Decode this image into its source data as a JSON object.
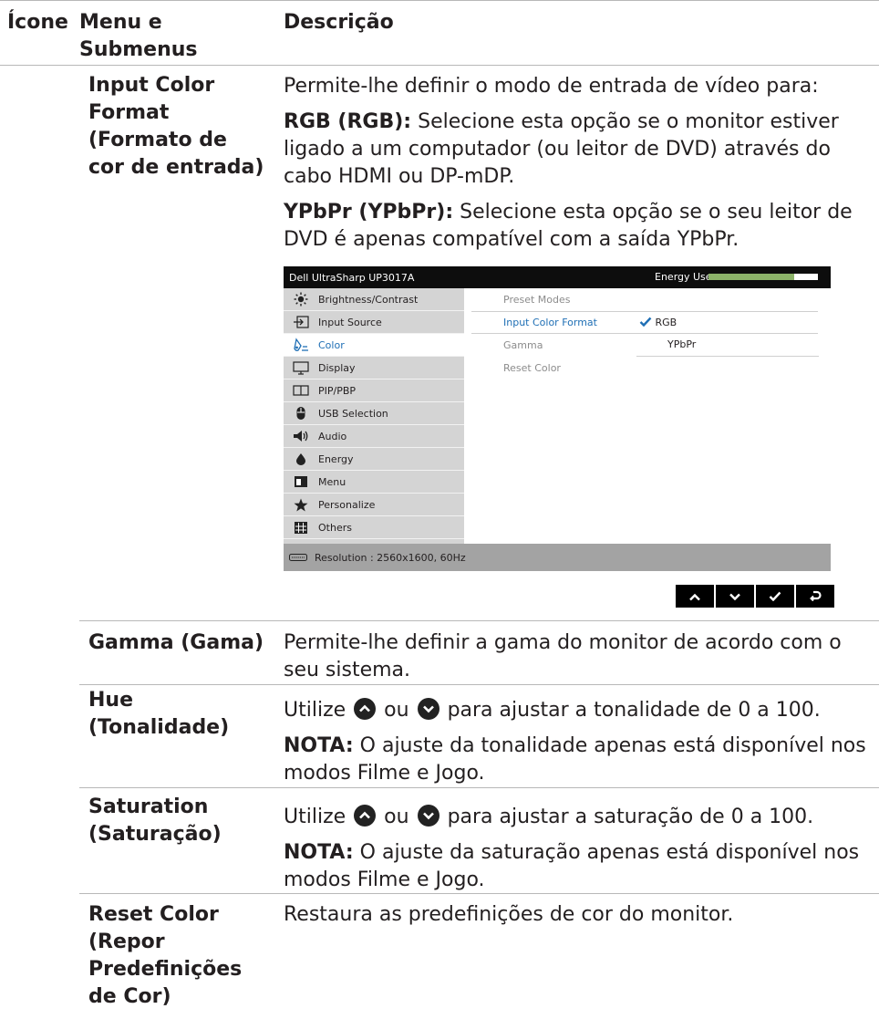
{
  "header": {
    "icon": "Ícone",
    "menu_line1": "Menu e",
    "menu_line2": "Submenus",
    "desc": "Descrição"
  },
  "rows": {
    "input_color": {
      "term": [
        "Input Color",
        "Format",
        "(Formato de",
        "cor de entrada)"
      ],
      "intro": "Permite-lhe definir o modo de entrada de vídeo para:",
      "rgb_bold": "RGB (RGB):",
      "rgb_lines": [
        " Selecione esta opção se o monitor estiver",
        "ligado a um computador (ou leitor de DVD) através do",
        "cabo HDMI ou DP-mDP."
      ],
      "ypbpr_bold": "YPbPr (YPbPr):",
      "ypbpr_lines": [
        " Selecione esta opção se o seu leitor de",
        "DVD é apenas compatível com a saída YPbPr."
      ]
    },
    "gamma": {
      "term": "Gamma (Gama)",
      "desc": [
        "Permite-lhe definir a gama do monitor de acordo com o",
        "seu sistema."
      ]
    },
    "hue": {
      "term": [
        "Hue",
        "(Tonalidade)"
      ],
      "pre": "Utilize",
      "mid": "ou",
      "post": "para ajustar a tonalidade de 0 a 100.",
      "note_bold": "NOTA:",
      "note": [
        " O ajuste da tonalidade apenas está disponível nos",
        "modos Filme e Jogo."
      ]
    },
    "saturation": {
      "term": [
        "Saturation",
        "(Saturação)"
      ],
      "pre": "Utilize",
      "mid": "ou",
      "post": "para ajustar a saturação de 0 a 100.",
      "note_bold": "NOTA:",
      "note": [
        " O ajuste da saturação apenas está disponível nos",
        "modos Filme e Jogo."
      ]
    },
    "reset": {
      "term": [
        "Reset Color",
        "(Repor",
        "Predefinições",
        "de Cor)"
      ],
      "desc": "Restaura as predefinições de cor do monitor."
    }
  },
  "osd": {
    "title": "Dell UltraSharp UP3017A",
    "energy_label": "Energy Use",
    "energy_level": 0.78,
    "menu": [
      {
        "label": "Brightness/Contrast",
        "icon": "sun-icon"
      },
      {
        "label": "Input Source",
        "icon": "input-icon"
      },
      {
        "label": "Color",
        "icon": "color-icon"
      },
      {
        "label": "Display",
        "icon": "monitor-icon"
      },
      {
        "label": "PIP/PBP",
        "icon": "pip-icon"
      },
      {
        "label": "USB Selection",
        "icon": "mouse-icon"
      },
      {
        "label": "Audio",
        "icon": "speaker-icon"
      },
      {
        "label": "Energy",
        "icon": "flame-icon"
      },
      {
        "label": "Menu",
        "icon": "menu-icon"
      },
      {
        "label": "Personalize",
        "icon": "star-icon"
      },
      {
        "label": "Others",
        "icon": "grid-icon"
      }
    ],
    "submenu": [
      "Preset Modes",
      "Input Color Format",
      "Gamma",
      "Reset Color"
    ],
    "options": {
      "rgb": "RGB",
      "ypbpr": "YPbPr"
    },
    "resolution": "Resolution : 2560x1600, 60Hz"
  }
}
